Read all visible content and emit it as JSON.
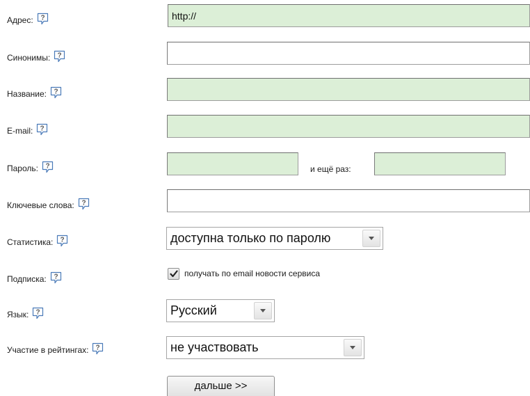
{
  "form": {
    "address": {
      "label": "Адрес:",
      "value": "http://"
    },
    "synonyms": {
      "label": "Синонимы:",
      "value": ""
    },
    "title": {
      "label": "Название:",
      "value": ""
    },
    "email": {
      "label": "E-mail:",
      "value": ""
    },
    "password": {
      "label": "Пароль:",
      "value": "",
      "again_label": "и ещё раз:",
      "again_value": ""
    },
    "keywords": {
      "label": "Ключевые слова:",
      "value": ""
    },
    "statistics": {
      "label": "Статистика:",
      "selected": "доступна только по паролю"
    },
    "subscription": {
      "label": "Подписка:",
      "checkbox_label": "получать по email новости сервиса",
      "checked": true
    },
    "language": {
      "label": "Язык:",
      "selected": "Русский"
    },
    "ratings": {
      "label": "Участие в рейтингах:",
      "selected": "не участвовать"
    },
    "help_icon": "question-help-icon",
    "next_button": "дальше >>"
  },
  "colors": {
    "required_field": "#dcefd7",
    "help_icon": "#4a7ab8"
  }
}
